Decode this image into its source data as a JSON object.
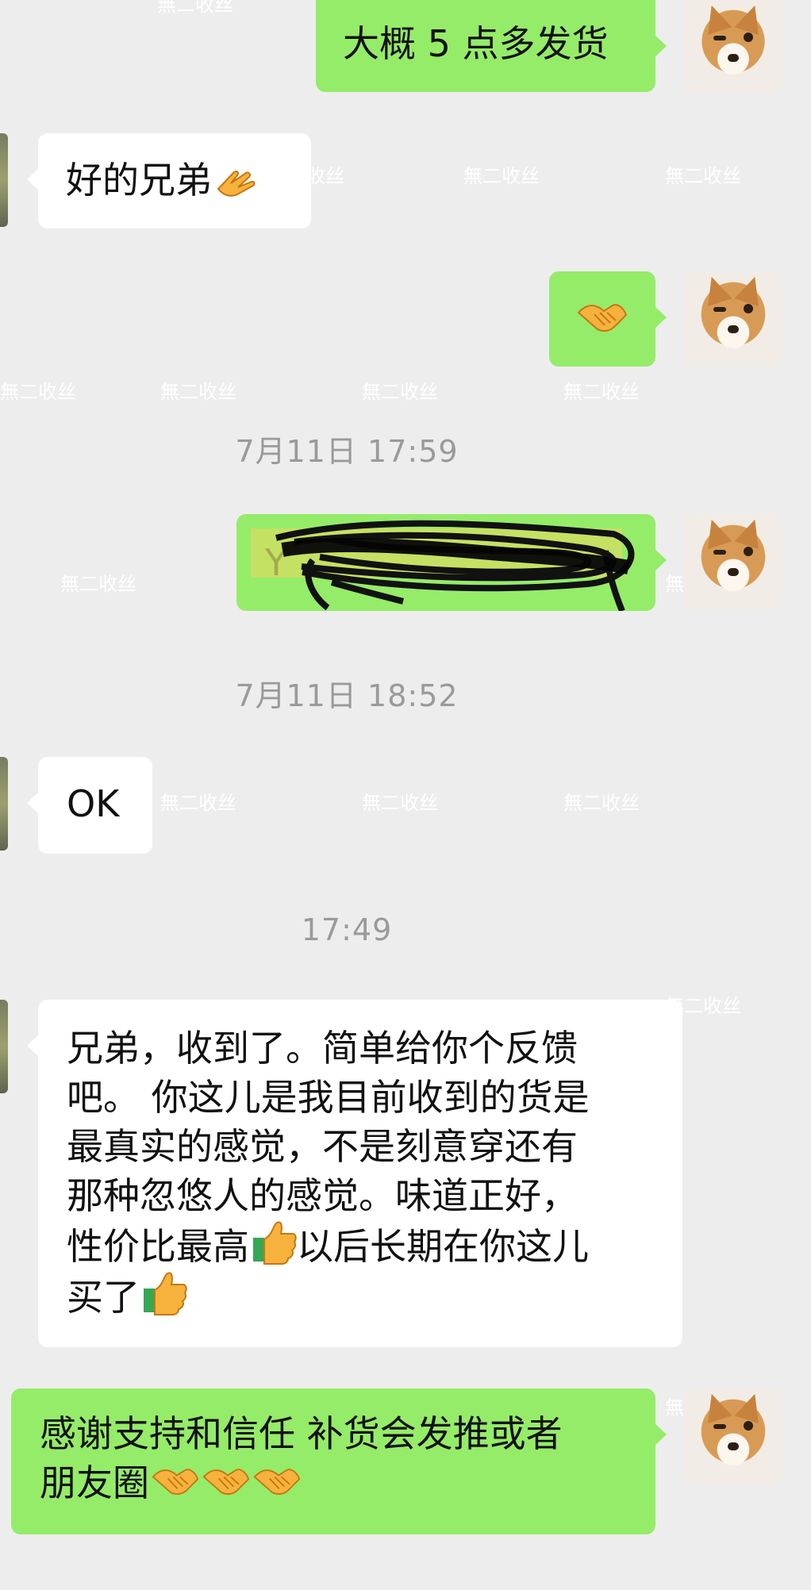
{
  "watermark_text": "無二收丝",
  "messages": [
    {
      "kind": "outgoing",
      "text": "大概 5 点多发货"
    },
    {
      "kind": "incoming",
      "text": "好的兄弟",
      "emoji": "ok-hand-icon"
    },
    {
      "kind": "outgoing",
      "emoji": "handshake-icon"
    },
    {
      "kind": "timestamp",
      "text": "7月11日 17:59"
    },
    {
      "kind": "outgoing",
      "text": "Y",
      "redacted": true
    },
    {
      "kind": "timestamp",
      "text": "7月11日 18:52"
    },
    {
      "kind": "incoming",
      "text": "OK"
    },
    {
      "kind": "timestamp",
      "text": "17:49"
    },
    {
      "kind": "incoming",
      "lines": [
        "兄弟，收到了。简单给你个反馈",
        "吧。 你这儿是我目前收到的货是",
        "最真实的感觉，不是刻意穿还有",
        "那种忽悠人的感觉。味道正好，",
        "性价比最高",
        "以后长期在你这儿",
        "买了"
      ],
      "emoji": "thumbs-up-icon"
    },
    {
      "kind": "outgoing",
      "lines": [
        "感谢支持和信任 补货会发推或者",
        "朋友圈"
      ],
      "emoji": "handshake-icon"
    }
  ],
  "colors": {
    "background": "#ededed",
    "incoming_bubble": "#ffffff",
    "outgoing_bubble": "#95ec69",
    "timestamp": "#9a9a9a",
    "avatar_fur": "#d89b55"
  }
}
